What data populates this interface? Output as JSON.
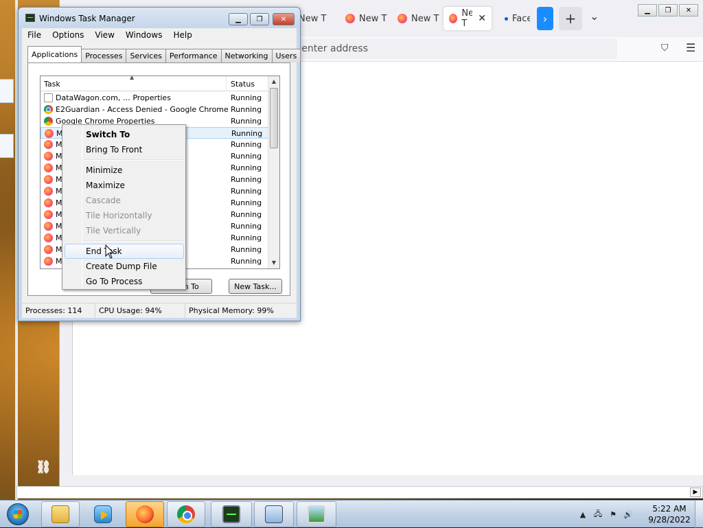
{
  "task_manager": {
    "title": "Windows Task Manager",
    "menu": [
      "File",
      "Options",
      "View",
      "Windows",
      "Help"
    ],
    "tabs": [
      "Applications",
      "Processes",
      "Services",
      "Performance",
      "Networking",
      "Users"
    ],
    "active_tab": "Applications",
    "columns": {
      "task": "Task",
      "status": "Status"
    },
    "rows": [
      {
        "icon": "page-icon",
        "name": "DataWagon.com, … Properties",
        "status": "Running"
      },
      {
        "icon": "chrome-icon",
        "name": "E2Guardian - Access Denied - Google Chrome",
        "status": "Running"
      },
      {
        "icon": "chrome-properties-icon",
        "name": "Google Chrome Properties",
        "status": "Running"
      },
      {
        "icon": "firefox-icon",
        "name": "Mo",
        "status": "Running",
        "selected": true
      },
      {
        "icon": "firefox-icon",
        "name": "Mo",
        "status": "Running"
      },
      {
        "icon": "firefox-icon",
        "name": "Mo",
        "status": "Running"
      },
      {
        "icon": "firefox-icon",
        "name": "Mo",
        "status": "Running"
      },
      {
        "icon": "firefox-icon",
        "name": "Mo",
        "status": "Running"
      },
      {
        "icon": "firefox-icon",
        "name": "Mo",
        "status": "Running"
      },
      {
        "icon": "firefox-icon",
        "name": "Mo",
        "status": "Running"
      },
      {
        "icon": "firefox-icon",
        "name": "Mo",
        "status": "Running"
      },
      {
        "icon": "firefox-icon",
        "name": "Mo",
        "status": "Running"
      },
      {
        "icon": "firefox-icon",
        "name": "Mo",
        "status": "Running"
      },
      {
        "icon": "firefox-icon",
        "name": "Mo",
        "status": "Running"
      },
      {
        "icon": "firefox-icon",
        "name": "Mo",
        "status": "Running"
      }
    ],
    "buttons": {
      "end_task": "End Task",
      "switch_to": "Switch To",
      "new_task": "New Task..."
    },
    "status_bar": {
      "processes": "Processes: 114",
      "cpu": "CPU Usage: 94%",
      "memory": "Physical Memory: 99%"
    }
  },
  "context_menu": {
    "items": [
      {
        "label": "Switch To",
        "bold": true
      },
      {
        "label": "Bring To Front"
      },
      {
        "separator": true
      },
      {
        "label": "Minimize"
      },
      {
        "label": "Maximize"
      },
      {
        "label": "Cascade",
        "disabled": true
      },
      {
        "label": "Tile Horizontally",
        "disabled": true
      },
      {
        "label": "Tile Vertically",
        "disabled": true
      },
      {
        "separator": true
      },
      {
        "label": "End Task",
        "hover": true
      },
      {
        "label": "Create Dump File"
      },
      {
        "label": "Go To Process"
      }
    ]
  },
  "firefox": {
    "tabs": [
      {
        "label": "New T",
        "icon": "firefox-icon"
      },
      {
        "label": "New T",
        "icon": "firefox-icon"
      },
      {
        "label": "New T",
        "icon": "firefox-icon"
      },
      {
        "label": "New T",
        "icon": "firefox-icon",
        "active": true
      },
      {
        "label": "Faceb",
        "icon": "dot-icon"
      }
    ],
    "urlbar_placeholder": "r enter address",
    "new_tab_label": "+"
  },
  "taskbar": {
    "clock_time": "5:22 AM",
    "clock_date": "9/28/2022",
    "pinned": [
      "explorer-icon",
      "media-player-icon",
      "firefox-icon",
      "chrome-icon",
      "task-manager-icon",
      "remote-desktop-icon",
      "photo-viewer-icon"
    ]
  }
}
